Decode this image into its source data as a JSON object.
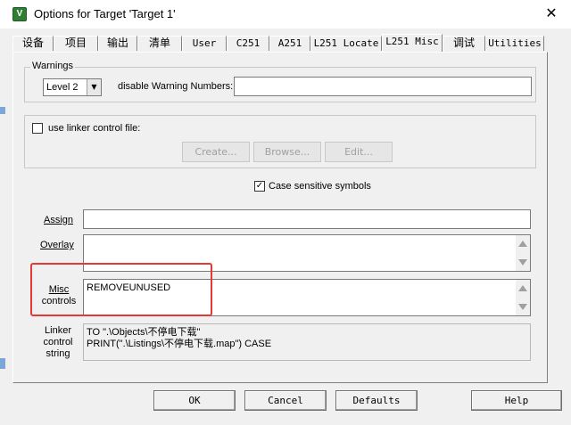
{
  "window": {
    "title": "Options for Target 'Target 1'",
    "close_glyph": "✕",
    "app_icon": "uvision-icon"
  },
  "tabs": [
    {
      "label": "设备"
    },
    {
      "label": "项目"
    },
    {
      "label": "输出"
    },
    {
      "label": "清单"
    },
    {
      "label": "User"
    },
    {
      "label": "C251"
    },
    {
      "label": "A251"
    },
    {
      "label": "L251 Locate"
    },
    {
      "label": "L251 Misc",
      "active": true
    },
    {
      "label": "调试"
    },
    {
      "label": "Utilities"
    }
  ],
  "warnings": {
    "group_label": "Warnings",
    "level_value": "Level 2",
    "disable_label": "disable Warning Numbers:",
    "disable_value": ""
  },
  "linker_file": {
    "checkbox_label": "use linker control file:",
    "checked": false,
    "create_label": "Create...",
    "browse_label": "Browse...",
    "edit_label": "Edit..."
  },
  "case_sensitive": {
    "label": "Case sensitive symbols",
    "checked": true,
    "check_glyph": "✓"
  },
  "assign": {
    "label": "Assign",
    "value": ""
  },
  "overlay": {
    "label": "Overlay",
    "value": ""
  },
  "misc": {
    "label_line1": "Misc",
    "label_line2": "controls",
    "value": "REMOVEUNUSED"
  },
  "linker_string": {
    "label_line1": "Linker",
    "label_line2": "control",
    "label_line3": "string",
    "line1": "TO \".\\Objects\\不停电下载\"",
    "line2": "PRINT(\".\\Listings\\不停电下载.map\") CASE"
  },
  "buttons": {
    "ok": "OK",
    "cancel": "Cancel",
    "defaults": "Defaults",
    "help": "Help"
  },
  "colors": {
    "highlight": "#e53935",
    "window_bg": "#f0f0f0"
  }
}
